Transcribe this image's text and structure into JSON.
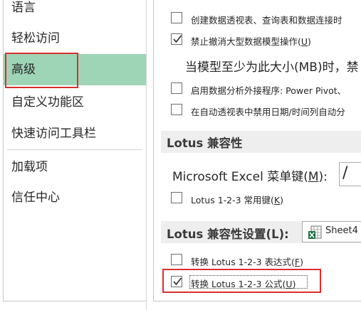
{
  "nav": {
    "items": [
      {
        "label": "语言"
      },
      {
        "label": "轻松访问"
      },
      {
        "label": "高级",
        "selected": true
      },
      {
        "label": "自定义功能区"
      },
      {
        "label": "快速访问工具栏"
      },
      {
        "label": "加载项"
      },
      {
        "label": "信任中心"
      }
    ]
  },
  "data_options": {
    "create_relationships": {
      "label": "创建数据透视表、查询表和数据连接时",
      "checked": false
    },
    "disable_undo": {
      "label_main": "禁止撤消大型数据模型操作(",
      "label_key": "U",
      "label_end": ")",
      "checked": true
    },
    "threshold_label": "当模型至少为此大小(MB)时，禁",
    "enable_addins": {
      "label": "启用数据分析外接程序: Power Pivot、",
      "checked": false
    },
    "disable_date_grouping": {
      "label": "在自动透视表中禁用日期/时间列自动分",
      "checked": false
    }
  },
  "lotus_compat": {
    "title": "Lotus 兼容性",
    "menu_key_label_main": "Microsoft Excel 菜单键(",
    "menu_key_label_key": "M",
    "menu_key_label_end": "):",
    "menu_key_value": "/",
    "navigation_keys": {
      "label_main": "Lotus 1-2-3 常用键(",
      "label_key": "K",
      "label_end": ")",
      "checked": false
    }
  },
  "lotus_settings": {
    "title": "Lotus 兼容性设置(L):",
    "sheet_value": "Sheet4",
    "transition_formula_eval": {
      "label_main": "转换 Lotus 1-2-3 表达式(",
      "label_key": "F",
      "label_end": ")",
      "checked": false
    },
    "transition_formula_entry": {
      "label_main": "转换 Lotus 1-2-3 公式(",
      "label_key": "U",
      "label_end": ")",
      "checked": true
    }
  },
  "colors": {
    "selected_nav": "#9fd5b7",
    "highlight_red": "#d9302f",
    "section_bg": "#eeeeee",
    "excel_green": "#1f7244"
  }
}
